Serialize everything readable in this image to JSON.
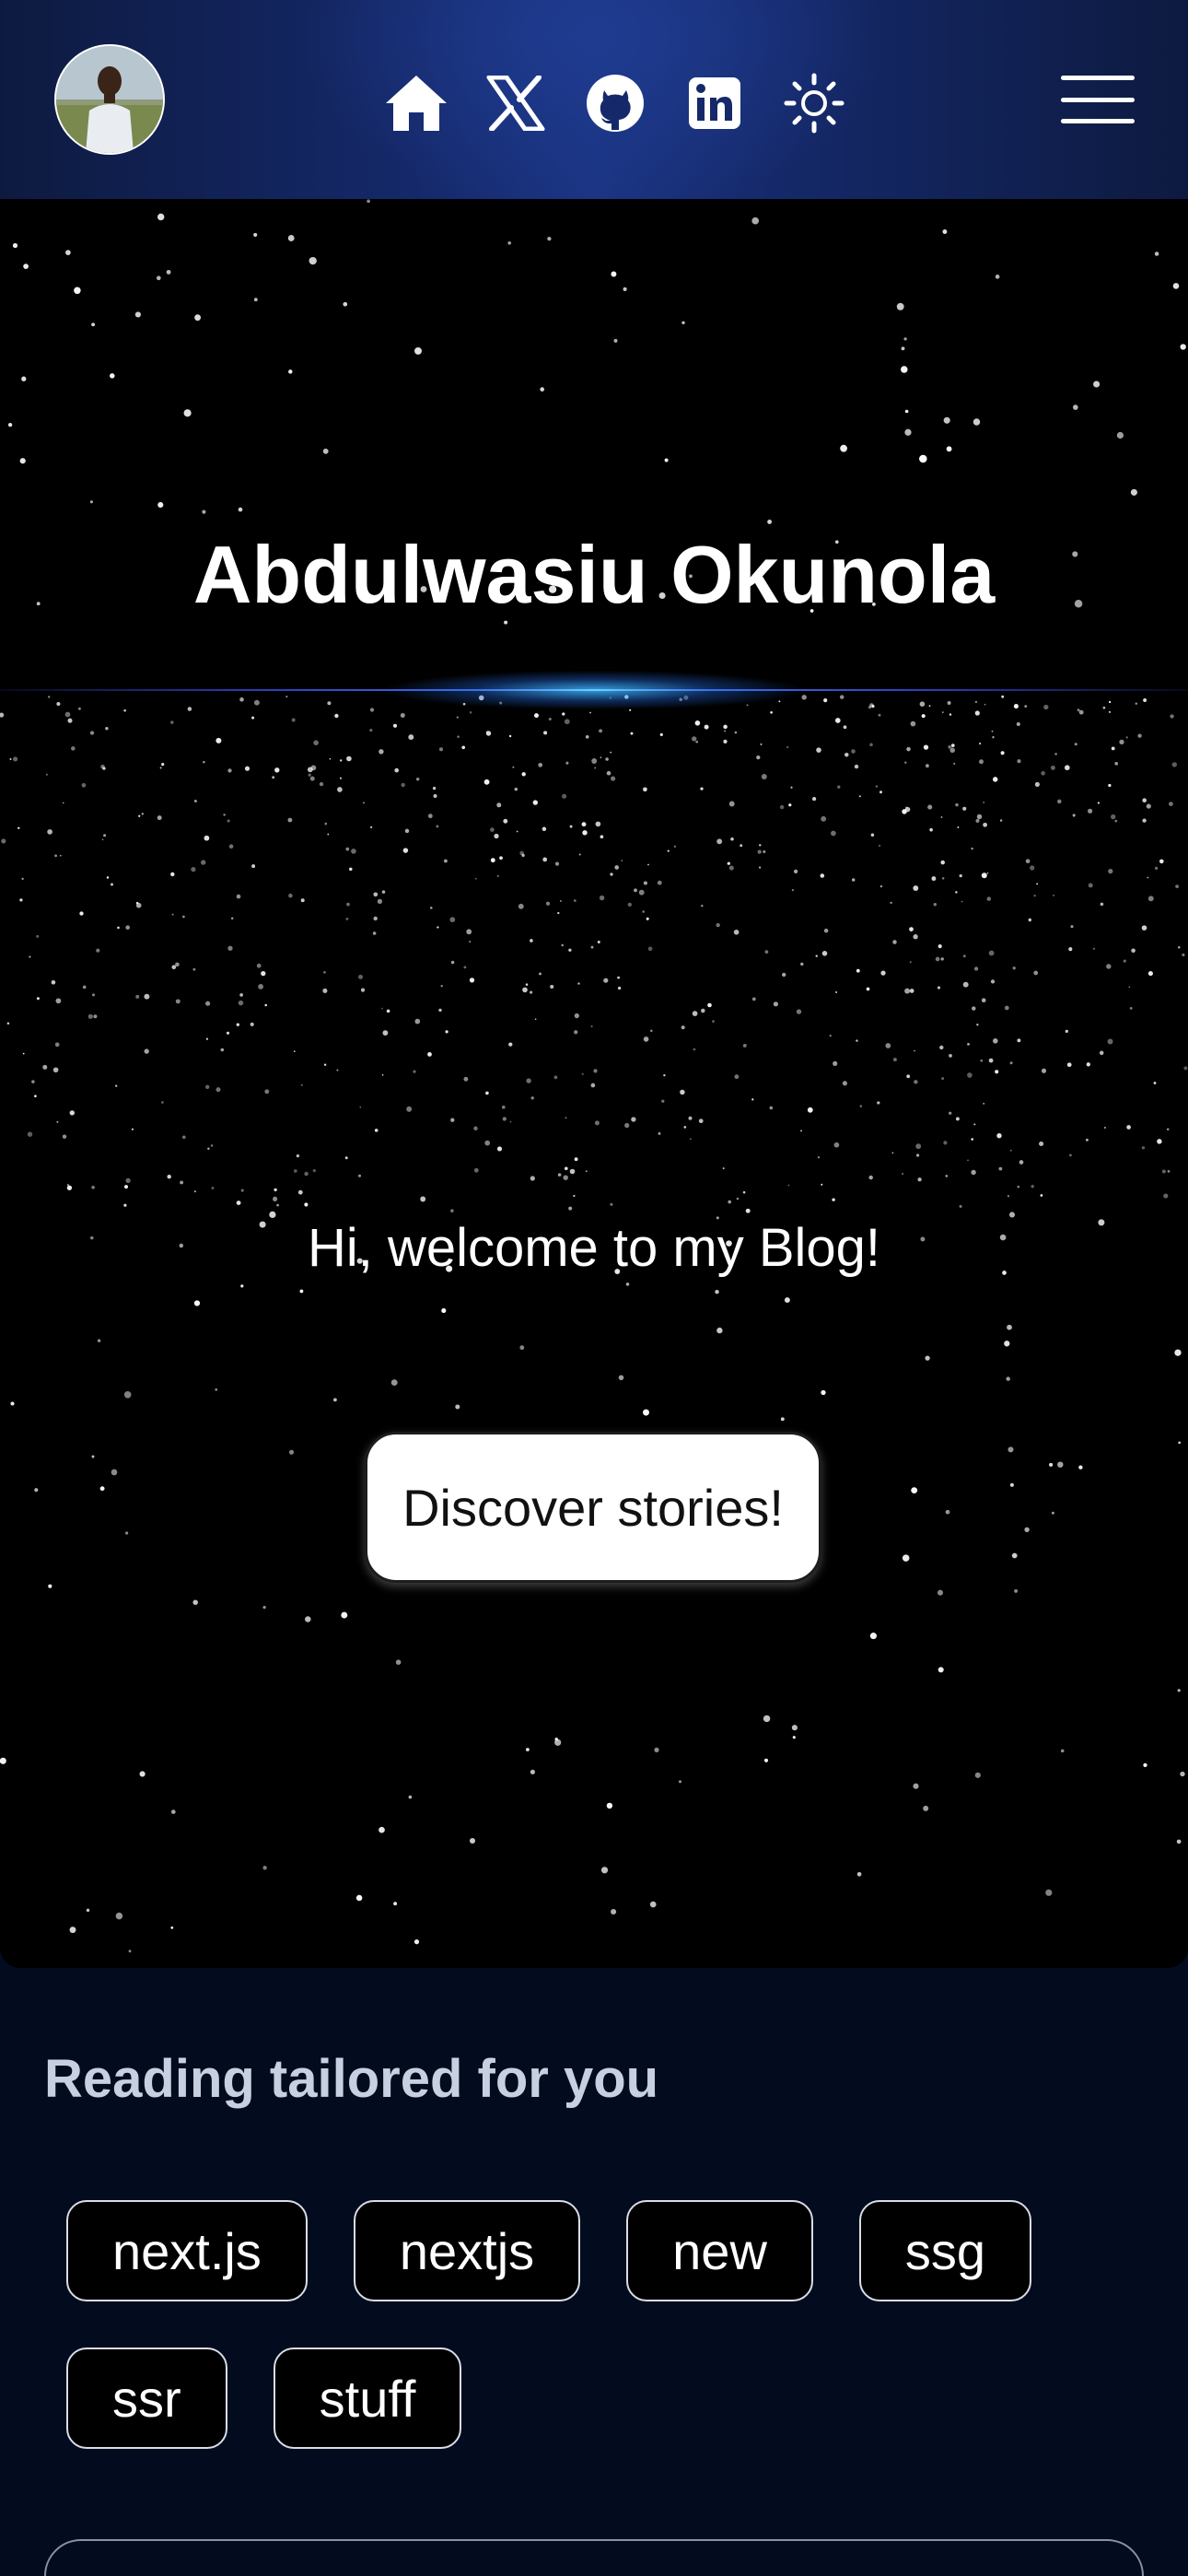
{
  "header": {
    "avatar_alt": "profile photo",
    "nav": [
      {
        "name": "home-icon"
      },
      {
        "name": "x-icon"
      },
      {
        "name": "github-icon"
      },
      {
        "name": "linkedin-icon"
      },
      {
        "name": "sun-icon"
      }
    ],
    "menu_icon": "hamburger-icon"
  },
  "hero": {
    "title": "Abdulwasiu Okunola",
    "welcome": "Hi, welcome to my Blog!",
    "cta_label": "Discover stories!"
  },
  "reading": {
    "title": "Reading tailored for you",
    "tags": [
      "next.js",
      "nextjs",
      "new",
      "ssg",
      "ssr",
      "stuff"
    ]
  },
  "colors": {
    "header_accent": "#1b3483",
    "glow": "#6ad0ff",
    "page_bg": "#030b1e",
    "section_title": "#c6d0e0"
  }
}
